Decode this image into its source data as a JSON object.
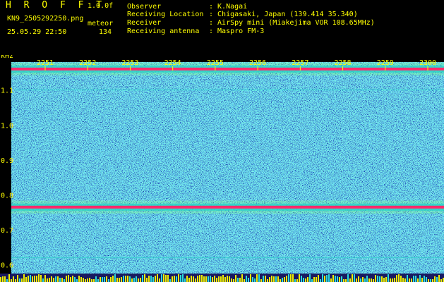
{
  "header": {
    "logo": "H R O F F T",
    "version": "1.0.0f",
    "filename": "KN9_2505292250.png",
    "meteor_label": "meteor",
    "timestamp": "25.05.29 22:50",
    "meteor_count": "134"
  },
  "info": [
    {
      "key": "Observer",
      "value": ": K.Nagai"
    },
    {
      "key": "Receiving Location",
      "value": ": Chigasaki, Japan (139.414 35.340)"
    },
    {
      "key": "Receiver",
      "value": ": AirSpy mini (Miakejima VOR 108.65MHz)"
    },
    {
      "key": "Receiving antenna",
      "value": ": Maspro FM-3"
    }
  ],
  "chart_data": {
    "type": "heatmap",
    "ylabel": "kHz",
    "x_ticks": [
      "2251",
      "2252",
      "2253",
      "2254",
      "2255",
      "2256",
      "2257",
      "2258",
      "2259",
      "2300"
    ],
    "y_ticks": [
      "1.1",
      "1.0",
      "0.9",
      "0.8",
      "0.7",
      "0.6"
    ],
    "ylim": [
      0.575,
      1.18
    ],
    "bands": [
      {
        "kHz": 1.16,
        "type": "strong"
      },
      {
        "kHz": 0.765,
        "type": "strong"
      },
      {
        "kHz": 1.1,
        "type": "faint"
      },
      {
        "kHz": 0.62,
        "type": "faint"
      }
    ],
    "colors": {
      "background": "#000000",
      "text": "#ffff00",
      "noise_low": "#0a1ea8",
      "noise_mid": "#1e5ad8",
      "signal_mid": "#28d2c8",
      "signal_high": "#ff2a6a",
      "grid": "#c8c8c8"
    }
  }
}
